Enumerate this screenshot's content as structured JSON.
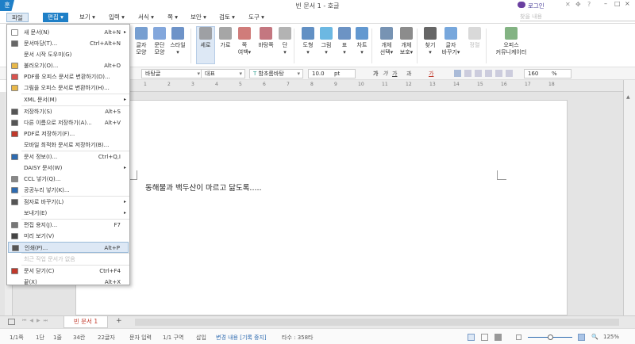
{
  "app": {
    "logo": "훈",
    "title": "빈 문서 1 - 호글",
    "login": "로그인",
    "find_placeholder": "찾을 내용",
    "help": "?"
  },
  "menubar": [
    "파일",
    "편집 ▾",
    "보기 ▾",
    "입력 ▾",
    "서식 ▾",
    "쪽 ▾",
    "보안 ▾",
    "검토 ▾",
    "도구 ▾"
  ],
  "ribbon": [
    {
      "label": "글자\n모양",
      "icon": "char-shape-icon",
      "color": "#4a7fc1"
    },
    {
      "label": "문단\n모양",
      "icon": "para-shape-icon",
      "color": "#5a8ad0"
    },
    {
      "label": "스타일\n▾",
      "icon": "style-icon",
      "color": "#3d6fb6"
    },
    {
      "label": "세로",
      "icon": "portrait-icon",
      "color": "#888",
      "selected": true
    },
    {
      "label": "가로",
      "icon": "landscape-icon",
      "color": "#888"
    },
    {
      "label": "쪽\n여백▾",
      "icon": "margin-icon",
      "color": "#c0504d"
    },
    {
      "label": "바탕쪽",
      "icon": "master-page-icon",
      "color": "#b04a55"
    },
    {
      "label": "단\n▾",
      "icon": "columns-icon",
      "color": "#999"
    },
    {
      "label": "도형\n▾",
      "icon": "shape-icon",
      "color": "#2e6bb0"
    },
    {
      "label": "그림\n▾",
      "icon": "picture-icon",
      "color": "#3ba0d8"
    },
    {
      "label": "표\n▾",
      "icon": "table-icon",
      "color": "#3b6fb0"
    },
    {
      "label": "차트\n▾",
      "icon": "chart-icon",
      "color": "#2e75c0"
    },
    {
      "label": "개체\n선택▾",
      "icon": "object-select-icon",
      "color": "#4a6f9a"
    },
    {
      "label": "개체\n보호▾",
      "icon": "object-protect-icon",
      "color": "#666"
    },
    {
      "label": "찾기\n▾",
      "icon": "find-icon",
      "color": "#333"
    },
    {
      "label": "글자\n바꾸기▾",
      "icon": "replace-icon",
      "color": "#4a8ad0"
    },
    {
      "label": "정렬",
      "icon": "sort-icon",
      "color": "#ccc",
      "disabled": true
    },
    {
      "label": "오피스\n커뮤니케이터",
      "icon": "communicator-icon",
      "color": "#5a9a5a"
    }
  ],
  "format": {
    "style": "바탕글",
    "lang": "대표",
    "font": "함초롬바탕",
    "size": "10.0",
    "unit": "pt",
    "zoom": "160",
    "zoom_unit": "%",
    "bold": "가",
    "italic": "가",
    "underline": "가",
    "strike": "과",
    "color": "가"
  },
  "ruler": [
    "1",
    "2",
    "3",
    "4",
    "5",
    "6",
    "7",
    "8",
    "9",
    "10",
    "11",
    "12",
    "13",
    "14",
    "15",
    "16",
    "17",
    "18"
  ],
  "document": {
    "text": "동해물과 백두산이 마르고 닳도록....."
  },
  "tabs": {
    "current": "빈 문서 1",
    "add": "+"
  },
  "status": {
    "page": "1/1쪽",
    "col": "1단",
    "line": "1줄",
    "pos": "34칸",
    "chars": "22글자",
    "mode": "문자 입력",
    "section": "1/1 구역",
    "insert": "삽입",
    "track": "변경 내용 [기록 중지]",
    "typing": "타수 : 358타",
    "zoom": "125%"
  },
  "file_menu": [
    {
      "label": "새 문서(N)",
      "shortcut": "Alt+N",
      "submenu": true,
      "icon": "new-doc-icon",
      "color": "#fff"
    },
    {
      "label": "문서마당(T)...",
      "shortcut": "Ctrl+Alt+N",
      "icon": "template-icon",
      "color": "#666"
    },
    {
      "label": "문서 시작 도우미(G)",
      "shortcut": ""
    },
    {
      "label": "불러오기(O)...",
      "shortcut": "Alt+O",
      "icon": "open-folder-icon",
      "color": "#e8b84a"
    },
    {
      "label": "PDF를 오피스 문서로 변환하기(D)...",
      "shortcut": "",
      "icon": "pdf-convert-icon",
      "color": "#d9534f"
    },
    {
      "label": "그림을 오피스 문서로 변환하기(H)...",
      "shortcut": "",
      "icon": "image-convert-icon",
      "color": "#e8b84a",
      "sep_after": true
    },
    {
      "label": "XML 문서(M)",
      "shortcut": "",
      "submenu": true,
      "sep_after": true
    },
    {
      "label": "저장하기(S)",
      "shortcut": "Alt+S",
      "icon": "save-icon",
      "color": "#555"
    },
    {
      "label": "다른 이름으로 저장하기(A)...",
      "shortcut": "Alt+V",
      "icon": "save-as-icon",
      "color": "#555"
    },
    {
      "label": "PDF로 저장하기(F)...",
      "shortcut": "",
      "icon": "save-pdf-icon",
      "color": "#c0392b"
    },
    {
      "label": "모바일 최적화 문서로 저장하기(B)...",
      "shortcut": "",
      "sep_after": true
    },
    {
      "label": "문서 정보(I)...",
      "shortcut": "Ctrl+Q,I",
      "icon": "info-icon",
      "color": "#2e6bb0"
    },
    {
      "label": "DAISY 문서(W)",
      "shortcut": "",
      "submenu": true
    },
    {
      "label": "CCL 넣기(Q)...",
      "shortcut": "",
      "icon": "ccl-icon",
      "color": "#888"
    },
    {
      "label": "공공누리 넣기(K)...",
      "shortcut": "",
      "icon": "kogl-icon",
      "color": "#2e6bb0",
      "sep_after": true
    },
    {
      "label": "점자로 바꾸기(L)",
      "shortcut": "",
      "submenu": true,
      "icon": "braille-icon",
      "color": "#555"
    },
    {
      "label": "보내기(E)",
      "shortcut": "",
      "submenu": true,
      "sep_after": true
    },
    {
      "label": "편집 용지(J)...",
      "shortcut": "F7",
      "icon": "page-setup-icon",
      "color": "#777"
    },
    {
      "label": "미리 보기(V)",
      "shortcut": "",
      "icon": "preview-icon",
      "color": "#444"
    },
    {
      "label": "인쇄(P)...",
      "shortcut": "Alt+P",
      "icon": "print-icon",
      "color": "#555",
      "highlight": true,
      "sep_after": true
    },
    {
      "label": "최근 작업 문서가 없음",
      "shortcut": "",
      "disabled": true,
      "sep_after": true
    },
    {
      "label": "문서 닫기(C)",
      "shortcut": "Ctrl+F4",
      "icon": "close-doc-icon",
      "color": "#c0392b"
    },
    {
      "label": "끝(X)",
      "shortcut": "Alt+X"
    }
  ]
}
